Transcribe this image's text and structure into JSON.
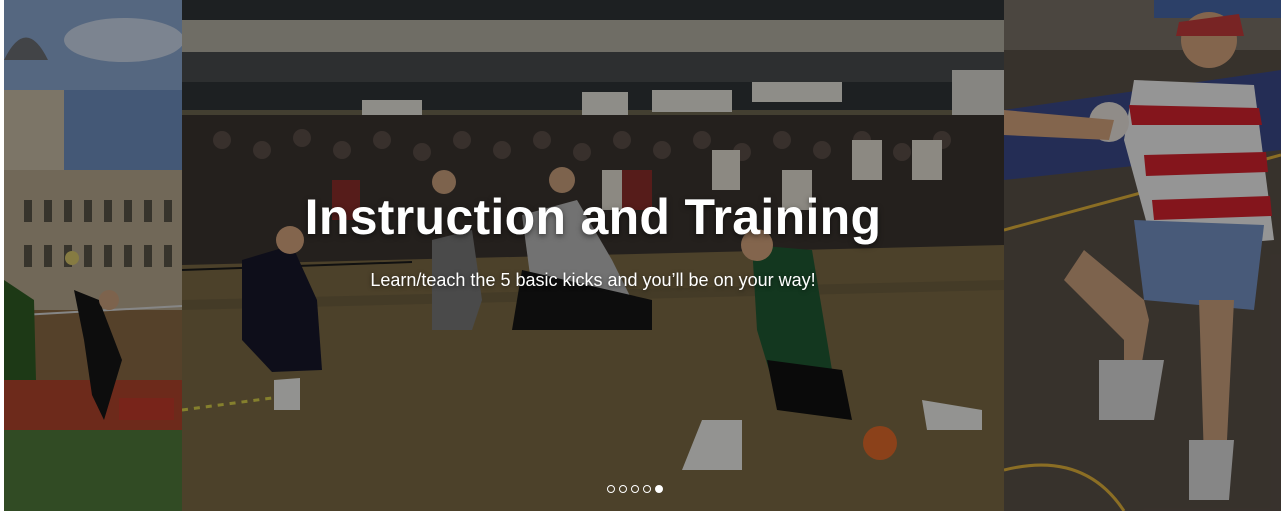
{
  "slide": {
    "title": "Instruction and Training",
    "subtitle": "Learn/teach the 5 basic kicks and you’ll be on your way!"
  },
  "pagination": {
    "count": 5,
    "active_index": 4
  },
  "images": {
    "left": "outdoor-footbag-match-photo",
    "center": "footbag-instruction-session-photo",
    "right": "footbag-player-kicking-photo"
  }
}
